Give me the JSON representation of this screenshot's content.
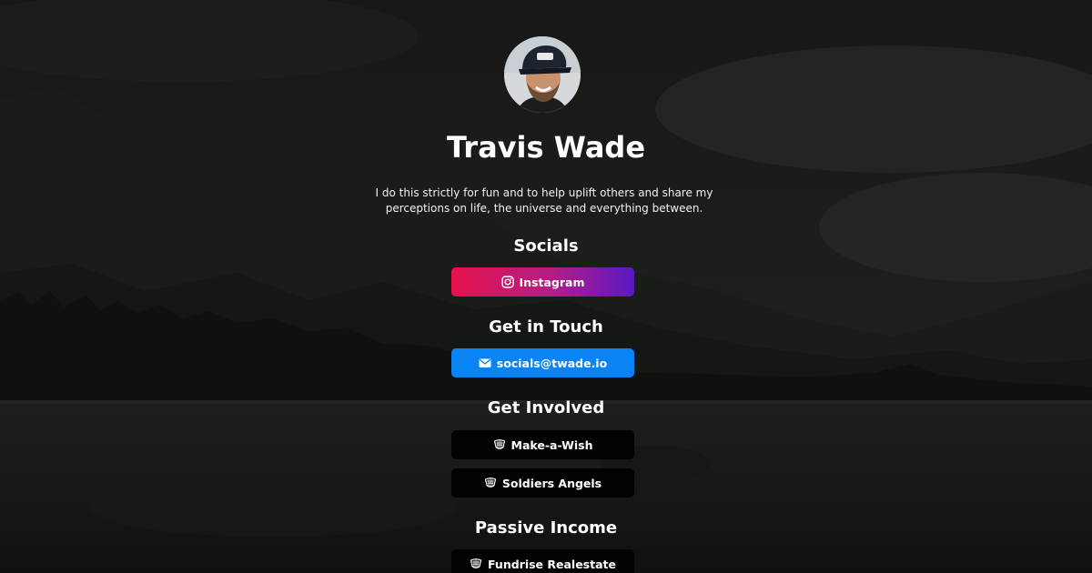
{
  "profile": {
    "name": "Travis Wade",
    "bio": "I do this strictly for fun and to help uplift others and share my perceptions on life, the universe and everything between."
  },
  "sections": {
    "socials": {
      "title": "Socials",
      "links": [
        {
          "label": "Instagram",
          "icon": "instagram-icon",
          "color": "#e6114b"
        }
      ]
    },
    "contact": {
      "title": "Get in Touch",
      "links": [
        {
          "label": "socials@twade.io",
          "icon": "envelope-icon",
          "color": "#0a84f5"
        }
      ]
    },
    "involved": {
      "title": "Get Involved",
      "links": [
        {
          "label": "Make-a-Wish",
          "icon": "badge-icon",
          "color": "#020202"
        },
        {
          "label": "Soldiers Angels",
          "icon": "badge-icon",
          "color": "#020202"
        }
      ]
    },
    "passive": {
      "title": "Passive Income",
      "links": [
        {
          "label": "Fundrise Realestate",
          "icon": "badge-icon",
          "color": "#020202"
        }
      ]
    }
  }
}
